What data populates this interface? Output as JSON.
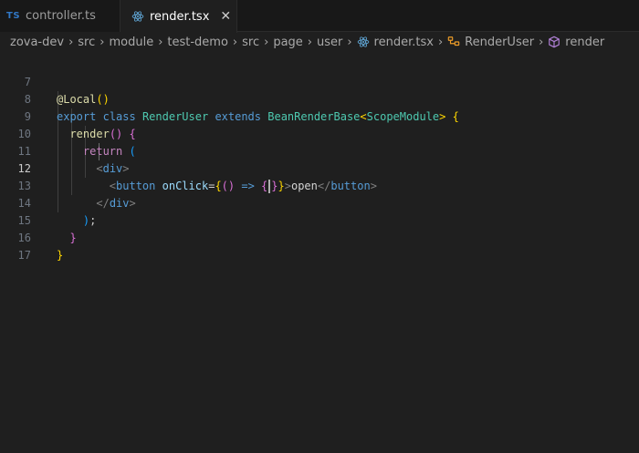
{
  "tabs": [
    {
      "badge": "TS",
      "label": "controller.ts",
      "active": false
    },
    {
      "label": "render.tsx",
      "active": true,
      "close": "✕"
    }
  ],
  "breadcrumb": {
    "items": [
      "zova-dev",
      "src",
      "module",
      "test-demo",
      "src",
      "page",
      "user"
    ],
    "file": "render.tsx",
    "class": "RenderUser",
    "method": "render"
  },
  "editor": {
    "line_numbers": [
      "7",
      "8",
      "9",
      "10",
      "11",
      "12",
      "13",
      "14",
      "15",
      "16",
      "17"
    ],
    "active_line": "12"
  },
  "code": {
    "l7": {
      "decorator": "@Local",
      "p1": "(",
      "p2": ")"
    },
    "l8": {
      "kw1": "export",
      "kw2": "class",
      "cls": "RenderUser",
      "kw3": "extends",
      "base": "BeanRenderBase",
      "lt": "<",
      "scope": "ScopeModule",
      "gt": ">",
      "brace": "{"
    },
    "l9": {
      "fn": "render",
      "paren": "()",
      "brace": "{"
    },
    "l10": {
      "kw": "return",
      "paren": "("
    },
    "l11": {
      "open": "<",
      "tag": "div",
      "close": ">"
    },
    "l12": {
      "open": "<",
      "tag": "button",
      "attr": "onClick",
      "eq": "=",
      "b1": "{",
      "p": "()",
      "arrow": "=>",
      "b2": "{",
      "b2close": "}",
      "b1close": "}",
      "gt": ">",
      "text": "open",
      "endopen": "</",
      "endtag": "button",
      "endclose": ">"
    },
    "l13": {
      "open": "</",
      "tag": "div",
      "close": ">"
    },
    "l14": {
      "paren": ")",
      "semi": ";"
    },
    "l15": {
      "brace": "}"
    },
    "l16": {
      "brace": "}"
    }
  }
}
